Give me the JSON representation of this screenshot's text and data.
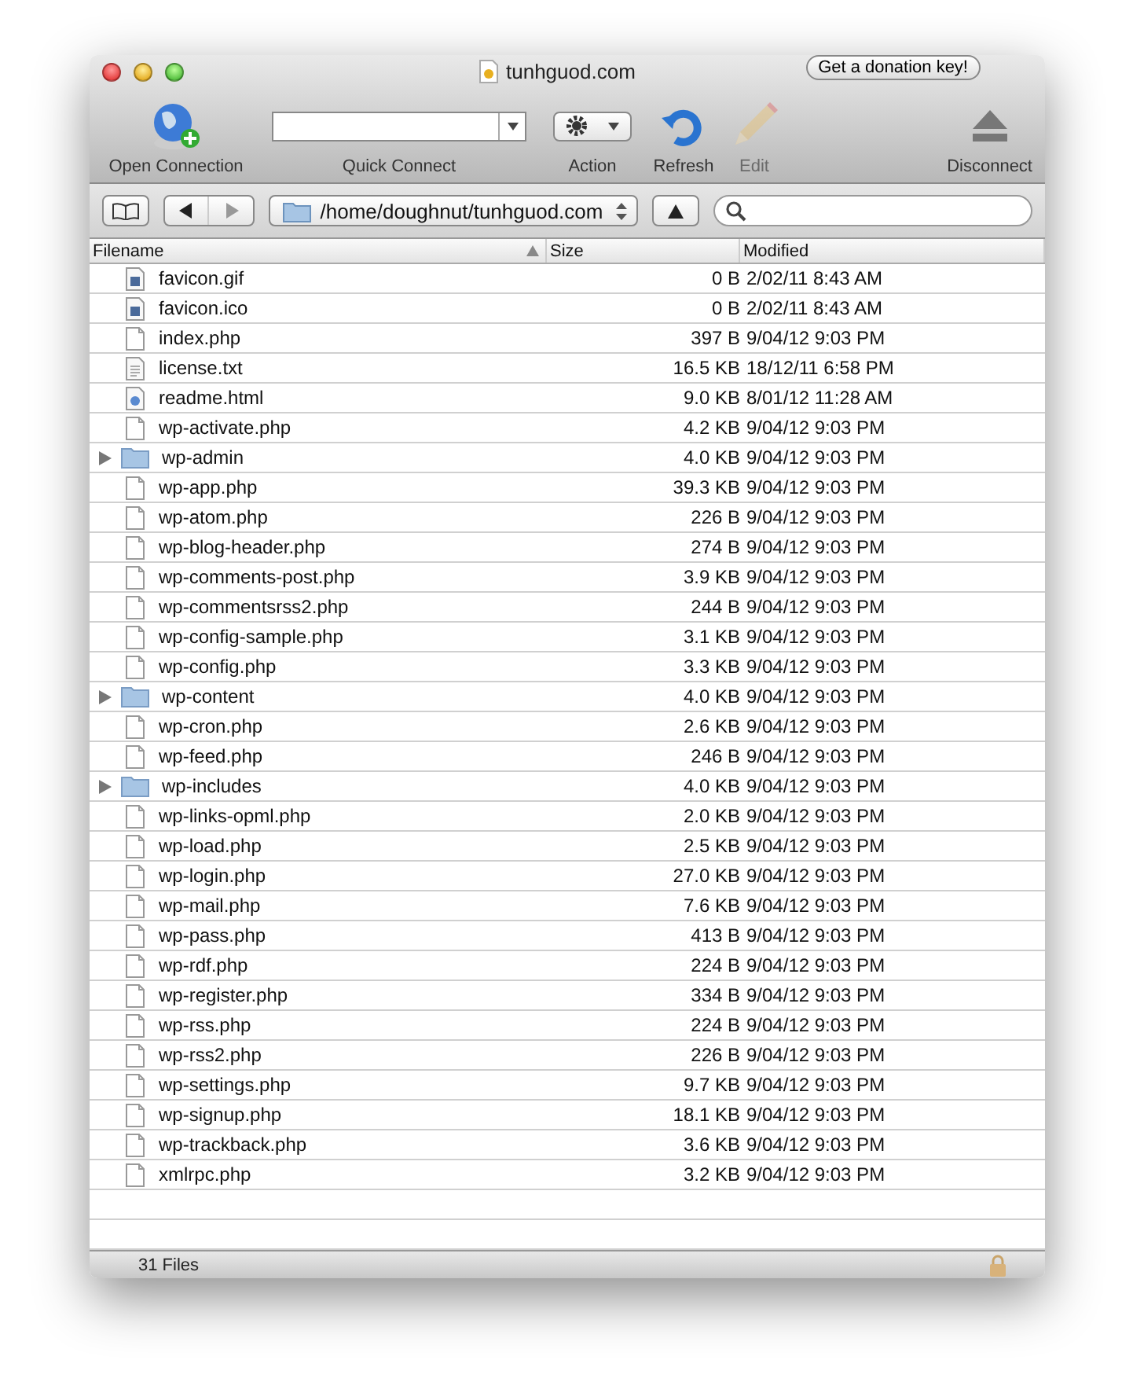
{
  "window": {
    "title": "tunhguod.com",
    "donation_button": "Get a donation key!"
  },
  "toolbar": [
    {
      "kind": "open",
      "label": "Open Connection",
      "disabled": false
    },
    {
      "kind": "quick",
      "label": "Quick Connect",
      "disabled": false
    },
    {
      "kind": "action",
      "label": "Action",
      "disabled": false
    },
    {
      "kind": "refresh",
      "label": "Refresh",
      "disabled": false
    },
    {
      "kind": "edit",
      "label": "Edit",
      "disabled": true
    },
    {
      "kind": "disconnect",
      "label": "Disconnect",
      "disabled": false
    }
  ],
  "path": "/home/doughnut/tunhguod.com",
  "table": {
    "columns": [
      {
        "label": "Filename",
        "sorted": true
      },
      {
        "label": "Size",
        "sorted": false
      },
      {
        "label": "Modified",
        "sorted": false
      }
    ],
    "rows": [
      {
        "kind": "image",
        "name": "favicon.gif",
        "size": "0 B",
        "modified": "2/02/11 8:43 AM"
      },
      {
        "kind": "image",
        "name": "favicon.ico",
        "size": "0 B",
        "modified": "2/02/11 8:43 AM"
      },
      {
        "kind": "file",
        "name": "index.php",
        "size": "397 B",
        "modified": "9/04/12 9:03 PM"
      },
      {
        "kind": "text",
        "name": "license.txt",
        "size": "16.5 KB",
        "modified": "18/12/11 6:58 PM"
      },
      {
        "kind": "html",
        "name": "readme.html",
        "size": "9.0 KB",
        "modified": "8/01/12 11:28 AM"
      },
      {
        "kind": "file",
        "name": "wp-activate.php",
        "size": "4.2 KB",
        "modified": "9/04/12 9:03 PM"
      },
      {
        "kind": "folder",
        "expanded": false,
        "name": "wp-admin",
        "size": "4.0 KB",
        "modified": "9/04/12 9:03 PM"
      },
      {
        "kind": "file",
        "name": "wp-app.php",
        "size": "39.3 KB",
        "modified": "9/04/12 9:03 PM"
      },
      {
        "kind": "file",
        "name": "wp-atom.php",
        "size": "226 B",
        "modified": "9/04/12 9:03 PM"
      },
      {
        "kind": "file",
        "name": "wp-blog-header.php",
        "size": "274 B",
        "modified": "9/04/12 9:03 PM"
      },
      {
        "kind": "file",
        "name": "wp-comments-post.php",
        "size": "3.9 KB",
        "modified": "9/04/12 9:03 PM"
      },
      {
        "kind": "file",
        "name": "wp-commentsrss2.php",
        "size": "244 B",
        "modified": "9/04/12 9:03 PM"
      },
      {
        "kind": "file",
        "name": "wp-config-sample.php",
        "size": "3.1 KB",
        "modified": "9/04/12 9:03 PM"
      },
      {
        "kind": "file",
        "name": "wp-config.php",
        "size": "3.3 KB",
        "modified": "9/04/12 9:03 PM"
      },
      {
        "kind": "folder",
        "expanded": false,
        "name": "wp-content",
        "size": "4.0 KB",
        "modified": "9/04/12 9:03 PM"
      },
      {
        "kind": "file",
        "name": "wp-cron.php",
        "size": "2.6 KB",
        "modified": "9/04/12 9:03 PM"
      },
      {
        "kind": "file",
        "name": "wp-feed.php",
        "size": "246 B",
        "modified": "9/04/12 9:03 PM"
      },
      {
        "kind": "folder",
        "expanded": false,
        "name": "wp-includes",
        "size": "4.0 KB",
        "modified": "9/04/12 9:03 PM"
      },
      {
        "kind": "file",
        "name": "wp-links-opml.php",
        "size": "2.0 KB",
        "modified": "9/04/12 9:03 PM"
      },
      {
        "kind": "file",
        "name": "wp-load.php",
        "size": "2.5 KB",
        "modified": "9/04/12 9:03 PM"
      },
      {
        "kind": "file",
        "name": "wp-login.php",
        "size": "27.0 KB",
        "modified": "9/04/12 9:03 PM"
      },
      {
        "kind": "file",
        "name": "wp-mail.php",
        "size": "7.6 KB",
        "modified": "9/04/12 9:03 PM"
      },
      {
        "kind": "file",
        "name": "wp-pass.php",
        "size": "413 B",
        "modified": "9/04/12 9:03 PM"
      },
      {
        "kind": "file",
        "name": "wp-rdf.php",
        "size": "224 B",
        "modified": "9/04/12 9:03 PM"
      },
      {
        "kind": "file",
        "name": "wp-register.php",
        "size": "334 B",
        "modified": "9/04/12 9:03 PM"
      },
      {
        "kind": "file",
        "name": "wp-rss.php",
        "size": "224 B",
        "modified": "9/04/12 9:03 PM"
      },
      {
        "kind": "file",
        "name": "wp-rss2.php",
        "size": "226 B",
        "modified": "9/04/12 9:03 PM"
      },
      {
        "kind": "file",
        "name": "wp-settings.php",
        "size": "9.7 KB",
        "modified": "9/04/12 9:03 PM"
      },
      {
        "kind": "file",
        "name": "wp-signup.php",
        "size": "18.1 KB",
        "modified": "9/04/12 9:03 PM"
      },
      {
        "kind": "file",
        "name": "wp-trackback.php",
        "size": "3.6 KB",
        "modified": "9/04/12 9:03 PM"
      },
      {
        "kind": "file",
        "name": "xmlrpc.php",
        "size": "3.2 KB",
        "modified": "9/04/12 9:03 PM"
      }
    ]
  },
  "status_bar": {
    "text": "31 Files"
  }
}
